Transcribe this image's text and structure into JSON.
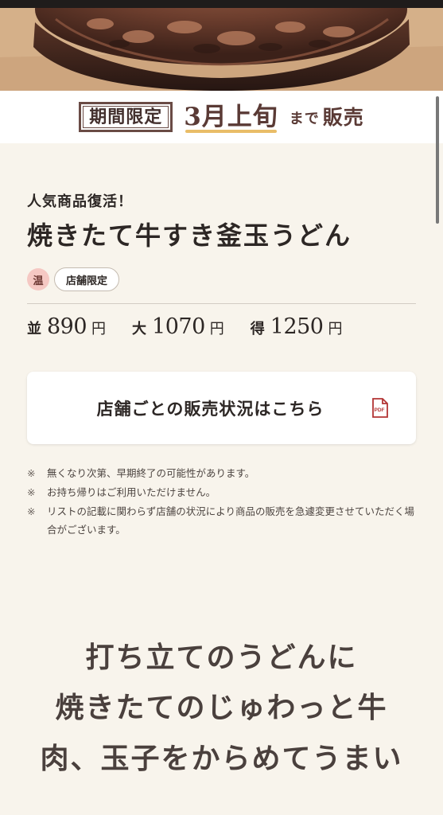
{
  "promo": {
    "limited_label": "期間限定",
    "sale_until": "3月上旬",
    "sale_suffix_small": "まで",
    "sale_suffix_large": "販売"
  },
  "product": {
    "subtitle": "人気商品復活！",
    "title": "焼きたて牛すき釜玉うどん",
    "temperature_badge": "温",
    "store_limited_tag": "店舗限定",
    "prices": [
      {
        "size": "並",
        "amount": "890",
        "unit": "円"
      },
      {
        "size": "大",
        "amount": "1070",
        "unit": "円"
      },
      {
        "size": "得",
        "amount": "1250",
        "unit": "円"
      }
    ]
  },
  "store_status": {
    "label": "店舗ごとの販売状況はこちら",
    "icon": "pdf-icon"
  },
  "notes": [
    {
      "mark": "※",
      "text": "無くなり次第、早期終了の可能性があります。"
    },
    {
      "mark": "※",
      "text": "お持ち帰りはご利用いただけません。"
    },
    {
      "mark": "※",
      "text": "リストの記載に関わらず店舗の状況により商品の販売を急遽変更させていただく場合がございます。"
    }
  ],
  "catch_copy": [
    "打ち立てのうどんに",
    "焼きたてのじゅわっと牛",
    "肉、玉子をからめてうまい"
  ],
  "colors": {
    "background": "#f8f4ec",
    "white": "#ffffff",
    "text": "#2d2725",
    "temperature_badge": "#f5c8c3",
    "pdf_icon": "#b33434"
  }
}
